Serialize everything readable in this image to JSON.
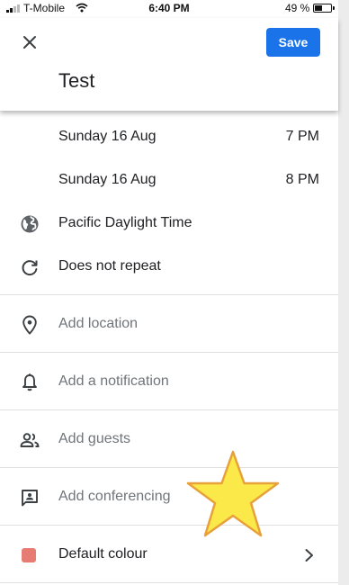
{
  "status_bar": {
    "carrier": "T-Mobile",
    "time": "6:40 PM",
    "battery": "49 %",
    "battery_level": 0.49,
    "signal_bars_filled": 2,
    "signal_bars_total": 4
  },
  "header": {
    "close_icon": "close-icon",
    "save_label": "Save",
    "title": "Test",
    "accent_color": "#1a73e8"
  },
  "form": {
    "start": {
      "date": "Sunday 16 Aug",
      "time": "7 PM"
    },
    "end": {
      "date": "Sunday 16 Aug",
      "time": "8 PM"
    },
    "timezone": {
      "icon": "globe-icon",
      "label": "Pacific Daylight Time"
    },
    "repeat": {
      "icon": "repeat-icon",
      "label": "Does not repeat"
    },
    "location": {
      "icon": "location-pin-icon",
      "label": "Add location"
    },
    "notification": {
      "icon": "bell-icon",
      "label": "Add a notification"
    },
    "guests": {
      "icon": "people-icon",
      "label": "Add guests"
    },
    "conferencing": {
      "icon": "video-chat-icon",
      "label": "Add conferencing"
    },
    "colour": {
      "label": "Default colour",
      "swatch": "#e67c73"
    }
  },
  "overlay": {
    "star_icon": "star-icon",
    "star_fill": "#fbe94a",
    "star_stroke": "#e8a13a"
  }
}
